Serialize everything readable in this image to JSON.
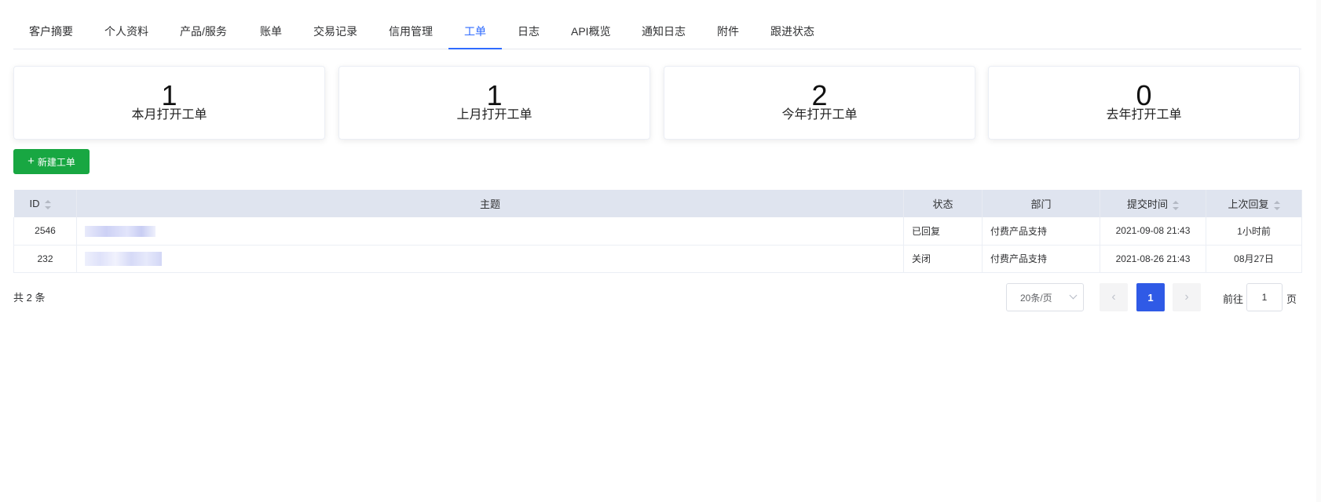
{
  "tabs": [
    {
      "label": "客户摘要",
      "active": false
    },
    {
      "label": "个人资料",
      "active": false
    },
    {
      "label": "产品/服务",
      "active": false
    },
    {
      "label": "账单",
      "active": false
    },
    {
      "label": "交易记录",
      "active": false
    },
    {
      "label": "信用管理",
      "active": false
    },
    {
      "label": "工单",
      "active": true
    },
    {
      "label": "日志",
      "active": false
    },
    {
      "label": "API概览",
      "active": false
    },
    {
      "label": "通知日志",
      "active": false
    },
    {
      "label": "附件",
      "active": false
    },
    {
      "label": "跟进状态",
      "active": false
    }
  ],
  "stats": [
    {
      "value": "1",
      "label": "本月打开工单"
    },
    {
      "value": "1",
      "label": "上月打开工单"
    },
    {
      "value": "2",
      "label": "今年打开工单"
    },
    {
      "value": "0",
      "label": "去年打开工单"
    }
  ],
  "new_button": {
    "icon": "plus-icon",
    "label": "新建工单",
    "color": "#18a742"
  },
  "table": {
    "headers": {
      "id": "ID",
      "subject": "主题",
      "status": "状态",
      "department": "部门",
      "submitted": "提交时间",
      "last_reply": "上次回复"
    },
    "rows": [
      {
        "id": "2546",
        "status": "已回复",
        "status_color": "#2bb34a",
        "department": "付费产品支持",
        "submitted": "2021-09-08 21:43",
        "last_reply": "1小时前"
      },
      {
        "id": "232",
        "status": "关闭",
        "status_color": "#909399",
        "department": "付费产品支持",
        "submitted": "2021-08-26 21:43",
        "last_reply": "08月27日"
      }
    ]
  },
  "pagination": {
    "total": "共 2 条",
    "page_size": "20条/页",
    "current_page": "1",
    "goto_prefix": "前往",
    "goto_value": "1",
    "goto_suffix": "页",
    "accent": "#2f5ae6"
  }
}
